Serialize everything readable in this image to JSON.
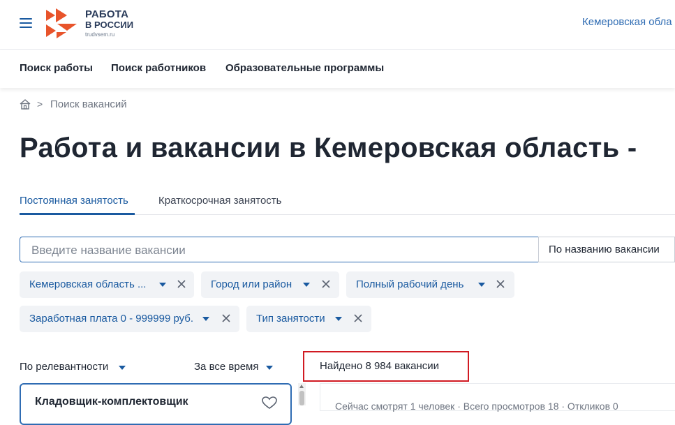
{
  "header": {
    "logo_line1": "РАБОТА",
    "logo_line2": "В РОССИИ",
    "logo_sub": "trudvsem.ru",
    "region": "Кемеровская обла",
    "accent": "#1a5aa0",
    "logo_color": "#e8542b"
  },
  "nav": {
    "items": [
      {
        "label": "Поиск работы"
      },
      {
        "label": "Поиск работников"
      },
      {
        "label": "Образовательные программы"
      }
    ]
  },
  "breadcrumb": {
    "separator": ">",
    "current": "Поиск вакансий"
  },
  "page_title": "Работа и вакансии в Кемеровская область -",
  "tabs": [
    {
      "label": "Постоянная занятость",
      "active": true
    },
    {
      "label": "Краткосрочная занятость",
      "active": false
    }
  ],
  "search": {
    "placeholder": "Введите название вакансии",
    "value": "",
    "mode": "По названию вакансии"
  },
  "filters": [
    {
      "label": "Кемеровская область ..."
    },
    {
      "label": "Город или район"
    },
    {
      "label": "Полный рабочий день"
    },
    {
      "label": "Заработная плата 0 - 999999 руб."
    },
    {
      "label": "Тип занятости"
    }
  ],
  "sort": {
    "relevance": "По релевантности",
    "period": "За все время"
  },
  "found": "Найдено 8 984 вакансии",
  "highlight_color": "#d11a22",
  "vacancy_card": {
    "title": "Кладовщик-комплектовщик"
  },
  "detail": {
    "stats": "Сейчас смотрят 1 человек · Всего просмотров 18 · Откликов 0"
  }
}
